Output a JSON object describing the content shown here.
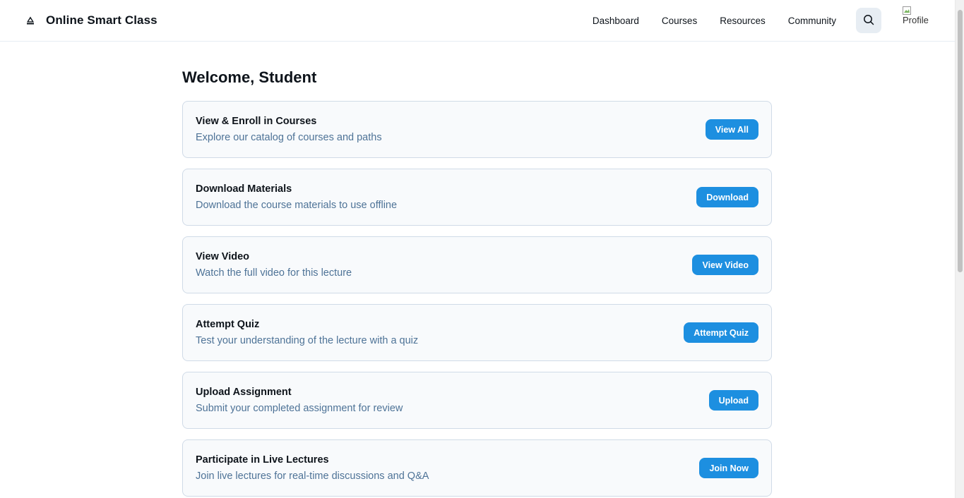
{
  "header": {
    "brand_title": "Online Smart Class",
    "nav": [
      "Dashboard",
      "Courses",
      "Resources",
      "Community"
    ],
    "search_icon": "search-icon",
    "profile_alt": "Profile"
  },
  "main": {
    "welcome": "Welcome, Student",
    "cards": [
      {
        "title": "View & Enroll in Courses",
        "description": "Explore our catalog of courses and paths",
        "button": "View All"
      },
      {
        "title": "Download Materials",
        "description": "Download the course materials to use offline",
        "button": "Download"
      },
      {
        "title": "View Video",
        "description": "Watch the full video for this lecture",
        "button": "View Video"
      },
      {
        "title": "Attempt Quiz",
        "description": "Test your understanding of the lecture with a quiz",
        "button": "Attempt Quiz"
      },
      {
        "title": "Upload Assignment",
        "description": "Submit your completed assignment for review",
        "button": "Upload"
      },
      {
        "title": "Participate in Live Lectures",
        "description": "Join live lectures for real-time discussions and Q&A",
        "button": "Join Now"
      }
    ]
  },
  "colors": {
    "accent": "#1d8fe0",
    "text_primary": "#0e141b",
    "text_secondary": "#4e7397",
    "card_bg": "#f8fafc",
    "card_border": "#d0dbe7"
  }
}
